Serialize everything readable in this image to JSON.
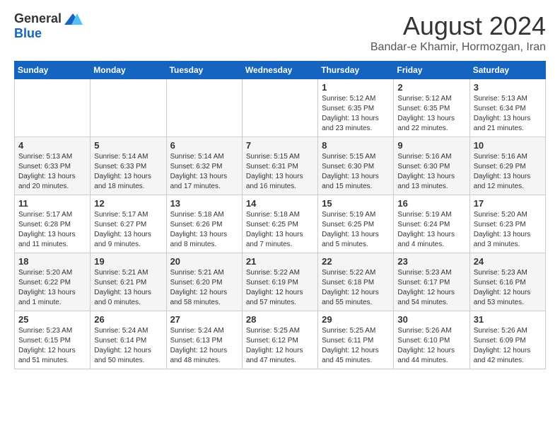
{
  "logo": {
    "general": "General",
    "blue": "Blue"
  },
  "title": "August 2024",
  "subtitle": "Bandar-e Khamir, Hormozgan, Iran",
  "headers": [
    "Sunday",
    "Monday",
    "Tuesday",
    "Wednesday",
    "Thursday",
    "Friday",
    "Saturday"
  ],
  "weeks": [
    [
      {
        "day": "",
        "info": ""
      },
      {
        "day": "",
        "info": ""
      },
      {
        "day": "",
        "info": ""
      },
      {
        "day": "",
        "info": ""
      },
      {
        "day": "1",
        "info": "Sunrise: 5:12 AM\nSunset: 6:35 PM\nDaylight: 13 hours\nand 23 minutes."
      },
      {
        "day": "2",
        "info": "Sunrise: 5:12 AM\nSunset: 6:35 PM\nDaylight: 13 hours\nand 22 minutes."
      },
      {
        "day": "3",
        "info": "Sunrise: 5:13 AM\nSunset: 6:34 PM\nDaylight: 13 hours\nand 21 minutes."
      }
    ],
    [
      {
        "day": "4",
        "info": "Sunrise: 5:13 AM\nSunset: 6:33 PM\nDaylight: 13 hours\nand 20 minutes."
      },
      {
        "day": "5",
        "info": "Sunrise: 5:14 AM\nSunset: 6:33 PM\nDaylight: 13 hours\nand 18 minutes."
      },
      {
        "day": "6",
        "info": "Sunrise: 5:14 AM\nSunset: 6:32 PM\nDaylight: 13 hours\nand 17 minutes."
      },
      {
        "day": "7",
        "info": "Sunrise: 5:15 AM\nSunset: 6:31 PM\nDaylight: 13 hours\nand 16 minutes."
      },
      {
        "day": "8",
        "info": "Sunrise: 5:15 AM\nSunset: 6:30 PM\nDaylight: 13 hours\nand 15 minutes."
      },
      {
        "day": "9",
        "info": "Sunrise: 5:16 AM\nSunset: 6:30 PM\nDaylight: 13 hours\nand 13 minutes."
      },
      {
        "day": "10",
        "info": "Sunrise: 5:16 AM\nSunset: 6:29 PM\nDaylight: 13 hours\nand 12 minutes."
      }
    ],
    [
      {
        "day": "11",
        "info": "Sunrise: 5:17 AM\nSunset: 6:28 PM\nDaylight: 13 hours\nand 11 minutes."
      },
      {
        "day": "12",
        "info": "Sunrise: 5:17 AM\nSunset: 6:27 PM\nDaylight: 13 hours\nand 9 minutes."
      },
      {
        "day": "13",
        "info": "Sunrise: 5:18 AM\nSunset: 6:26 PM\nDaylight: 13 hours\nand 8 minutes."
      },
      {
        "day": "14",
        "info": "Sunrise: 5:18 AM\nSunset: 6:25 PM\nDaylight: 13 hours\nand 7 minutes."
      },
      {
        "day": "15",
        "info": "Sunrise: 5:19 AM\nSunset: 6:25 PM\nDaylight: 13 hours\nand 5 minutes."
      },
      {
        "day": "16",
        "info": "Sunrise: 5:19 AM\nSunset: 6:24 PM\nDaylight: 13 hours\nand 4 minutes."
      },
      {
        "day": "17",
        "info": "Sunrise: 5:20 AM\nSunset: 6:23 PM\nDaylight: 13 hours\nand 3 minutes."
      }
    ],
    [
      {
        "day": "18",
        "info": "Sunrise: 5:20 AM\nSunset: 6:22 PM\nDaylight: 13 hours\nand 1 minute."
      },
      {
        "day": "19",
        "info": "Sunrise: 5:21 AM\nSunset: 6:21 PM\nDaylight: 13 hours\nand 0 minutes."
      },
      {
        "day": "20",
        "info": "Sunrise: 5:21 AM\nSunset: 6:20 PM\nDaylight: 12 hours\nand 58 minutes."
      },
      {
        "day": "21",
        "info": "Sunrise: 5:22 AM\nSunset: 6:19 PM\nDaylight: 12 hours\nand 57 minutes."
      },
      {
        "day": "22",
        "info": "Sunrise: 5:22 AM\nSunset: 6:18 PM\nDaylight: 12 hours\nand 55 minutes."
      },
      {
        "day": "23",
        "info": "Sunrise: 5:23 AM\nSunset: 6:17 PM\nDaylight: 12 hours\nand 54 minutes."
      },
      {
        "day": "24",
        "info": "Sunrise: 5:23 AM\nSunset: 6:16 PM\nDaylight: 12 hours\nand 53 minutes."
      }
    ],
    [
      {
        "day": "25",
        "info": "Sunrise: 5:23 AM\nSunset: 6:15 PM\nDaylight: 12 hours\nand 51 minutes."
      },
      {
        "day": "26",
        "info": "Sunrise: 5:24 AM\nSunset: 6:14 PM\nDaylight: 12 hours\nand 50 minutes."
      },
      {
        "day": "27",
        "info": "Sunrise: 5:24 AM\nSunset: 6:13 PM\nDaylight: 12 hours\nand 48 minutes."
      },
      {
        "day": "28",
        "info": "Sunrise: 5:25 AM\nSunset: 6:12 PM\nDaylight: 12 hours\nand 47 minutes."
      },
      {
        "day": "29",
        "info": "Sunrise: 5:25 AM\nSunset: 6:11 PM\nDaylight: 12 hours\nand 45 minutes."
      },
      {
        "day": "30",
        "info": "Sunrise: 5:26 AM\nSunset: 6:10 PM\nDaylight: 12 hours\nand 44 minutes."
      },
      {
        "day": "31",
        "info": "Sunrise: 5:26 AM\nSunset: 6:09 PM\nDaylight: 12 hours\nand 42 minutes."
      }
    ]
  ]
}
